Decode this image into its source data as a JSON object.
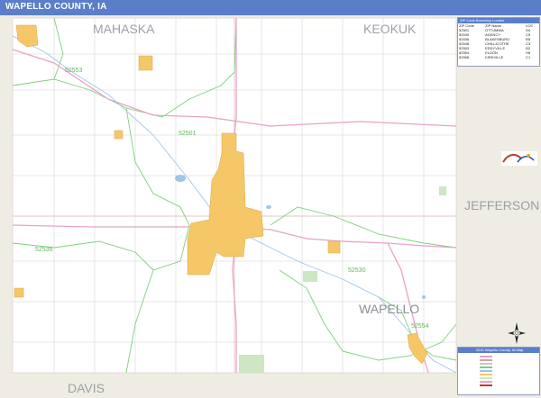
{
  "title": "WAPELLO COUNTY, IA",
  "neighbors": {
    "north_west": "MAHASKA",
    "north_east": "KEOKUK",
    "east": "JEFFERSON",
    "south": "DAVIS"
  },
  "county_label": "WAPELLO",
  "zip_labels": [
    "52553",
    "52501",
    "52536",
    "52530",
    "52554"
  ],
  "legend": {
    "header": "ZIP Code Boundary Locator",
    "columns": [
      "ZIP Code",
      "ZIP Name",
      "LOC"
    ],
    "rows": [
      [
        "52501",
        "OTTUMWA",
        "D4"
      ],
      [
        "52530",
        "AGENCY",
        "C5"
      ],
      [
        "52536",
        "BLAKESBURG",
        "B5"
      ],
      [
        "52548",
        "CHILLICOTHE",
        "C3"
      ],
      [
        "52553",
        "EDDYVILLE",
        "B2"
      ],
      [
        "52554",
        "ELDON",
        "H5"
      ],
      [
        "52566",
        "KIRKVILLE",
        "C1"
      ]
    ]
  },
  "inset": {
    "header": "2016 Wapello County, IA Map"
  },
  "colors": {
    "title_bar": "#5b7ec9",
    "city_fill": "#f6c767",
    "zip_boundary": "#7ed07a",
    "highway": "#e6a3c8",
    "road": "#c9c9c9",
    "land": "#ffffff",
    "outside": "#efece3",
    "park": "#cde6c3",
    "water": "#9fc5e8"
  }
}
